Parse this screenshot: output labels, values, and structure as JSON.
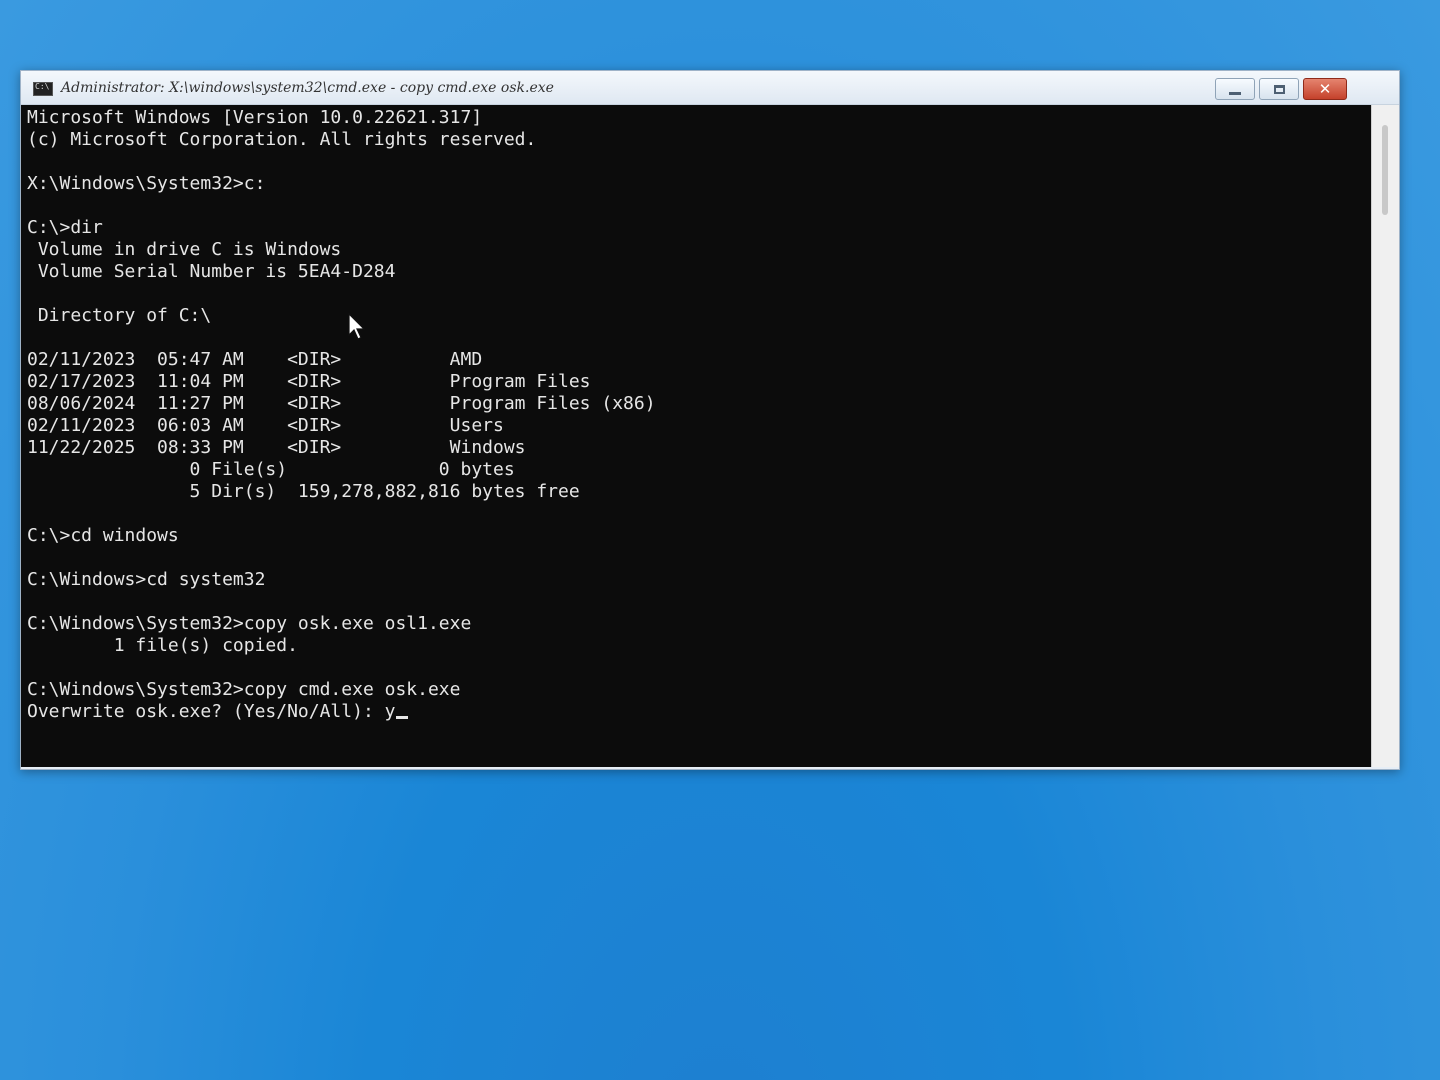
{
  "window": {
    "title": "Administrator: X:\\windows\\system32\\cmd.exe - copy  cmd.exe osk.exe",
    "min_glyph": "—",
    "max_glyph": "▢",
    "close_glyph": "✕"
  },
  "console": {
    "lines": [
      "Microsoft Windows [Version 10.0.22621.317]",
      "(c) Microsoft Corporation. All rights reserved.",
      "",
      "X:\\Windows\\System32>c:",
      "",
      "C:\\>dir",
      " Volume in drive C is Windows",
      " Volume Serial Number is 5EA4-D284",
      "",
      " Directory of C:\\",
      "",
      "02/11/2023  05:47 AM    <DIR>          AMD",
      "02/17/2023  11:04 PM    <DIR>          Program Files",
      "08/06/2024  11:27 PM    <DIR>          Program Files (x86)",
      "02/11/2023  06:03 AM    <DIR>          Users",
      "11/22/2025  08:33 PM    <DIR>          Windows",
      "               0 File(s)              0 bytes",
      "               5 Dir(s)  159,278,882,816 bytes free",
      "",
      "C:\\>cd windows",
      "",
      "C:\\Windows>cd system32",
      "",
      "C:\\Windows\\System32>copy osk.exe osl1.exe",
      "        1 file(s) copied.",
      "",
      "C:\\Windows\\System32>copy cmd.exe osk.exe",
      "Overwrite osk.exe? (Yes/No/All): y"
    ]
  },
  "colors": {
    "console_bg": "#0c0c0c",
    "console_fg": "#e6e6e6",
    "desktop_bg": "#1a86d6"
  },
  "icons": {
    "app_icon": "cmd-icon",
    "pointer": "mouse-pointer-icon"
  }
}
